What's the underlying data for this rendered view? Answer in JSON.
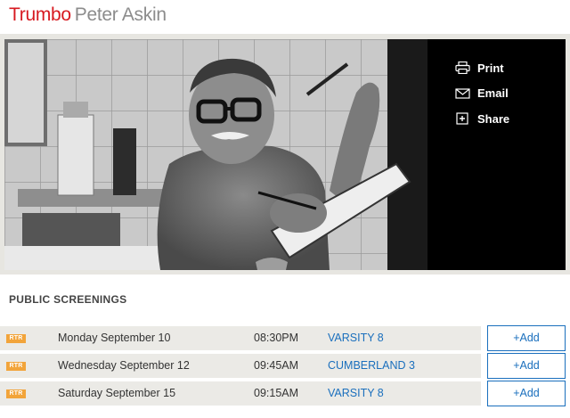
{
  "header": {
    "title": "Trumbo",
    "subtitle": "Peter Askin"
  },
  "photo": {
    "alt_subject": "photo-still"
  },
  "actions": [
    {
      "label": "Print",
      "icon": "printer-icon"
    },
    {
      "label": "Email",
      "icon": "envelope-icon"
    },
    {
      "label": "Share",
      "icon": "plus-box-icon"
    }
  ],
  "section": {
    "title": "PUBLIC SCREENINGS"
  },
  "screenings": [
    {
      "badge": "RTR",
      "date": "Monday September 10",
      "time": "08:30PM",
      "venue": "VARSITY 8",
      "button": "+Add"
    },
    {
      "badge": "RTR",
      "date": "Wednesday September 12",
      "time": "09:45AM",
      "venue": "CUMBERLAND 3",
      "button": "+Add"
    },
    {
      "badge": "RTR",
      "date": "Saturday September 15",
      "time": "09:15AM",
      "venue": "VARSITY 8",
      "button": "+Add"
    }
  ],
  "colors": {
    "title_red": "#d71920",
    "subtitle_gray": "#8c8c8c",
    "link_blue": "#1a6fbd",
    "badge_orange": "#f2a43a",
    "row_bg": "#ebeae6"
  }
}
